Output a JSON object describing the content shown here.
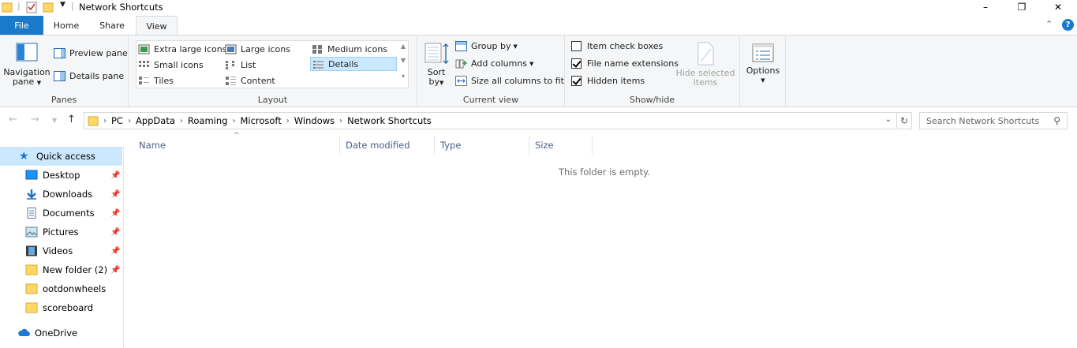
{
  "window": {
    "title": "Network Shortcuts",
    "minimize_glyph": "–",
    "restore_glyph": "❐",
    "close_glyph": "✕"
  },
  "tabs": [
    {
      "label": "File"
    },
    {
      "label": "Home"
    },
    {
      "label": "Share"
    },
    {
      "label": "View"
    }
  ],
  "ribbon": {
    "panes": {
      "navigation_pane_line1": "Navigation",
      "navigation_pane_line2": "pane",
      "preview_pane": "Preview pane",
      "details_pane": "Details pane",
      "label": "Panes"
    },
    "layout": {
      "items": [
        {
          "label": "Extra large icons"
        },
        {
          "label": "Large icons"
        },
        {
          "label": "Medium icons"
        },
        {
          "label": "Small icons"
        },
        {
          "label": "List"
        },
        {
          "label": "Details"
        },
        {
          "label": "Tiles"
        },
        {
          "label": "Content"
        }
      ],
      "selected": "Details",
      "label": "Layout"
    },
    "current_view": {
      "sort_line1": "Sort",
      "sort_line2": "by",
      "group_by": "Group by",
      "add_columns": "Add columns",
      "size_all_columns": "Size all columns to fit",
      "label": "Current view"
    },
    "show_hide": {
      "item_check_boxes": "Item check boxes",
      "file_name_extensions": "File name extensions",
      "hidden_items": "Hidden items",
      "hide_selected_line1": "Hide selected",
      "hide_selected_line2": "items",
      "label": "Show/hide",
      "item_check_boxes_checked": false,
      "file_name_extensions_checked": true,
      "hidden_items_checked": true
    },
    "options": {
      "label": "Options"
    }
  },
  "address": {
    "crumbs": [
      "PC",
      "AppData",
      "Roaming",
      "Microsoft",
      "Windows",
      "Network Shortcuts"
    ],
    "search_placeholder": "Search Network Shortcuts"
  },
  "nav_pane": {
    "items": [
      {
        "label": "Quick access",
        "icon": "star-icon"
      },
      {
        "label": "Desktop",
        "icon": "desktop-icon",
        "pinned": true
      },
      {
        "label": "Downloads",
        "icon": "download-arrow-icon",
        "pinned": true
      },
      {
        "label": "Documents",
        "icon": "document-icon",
        "pinned": true
      },
      {
        "label": "Pictures",
        "icon": "picture-icon",
        "pinned": true
      },
      {
        "label": "Videos",
        "icon": "film-icon",
        "pinned": true
      },
      {
        "label": "New folder (2)",
        "icon": "folder-icon",
        "pinned": true
      },
      {
        "label": "ootdonwheels",
        "icon": "folder-icon"
      },
      {
        "label": "scoreboard",
        "icon": "folder-icon"
      },
      {
        "label": "OneDrive",
        "icon": "cloud-icon"
      }
    ]
  },
  "columns": [
    {
      "label": "Name"
    },
    {
      "label": "Date modified"
    },
    {
      "label": "Type"
    },
    {
      "label": "Size"
    }
  ],
  "empty_message": "This folder is empty.",
  "colors": {
    "accent": "#1979ca",
    "selection": "#cce8ff",
    "folder": "#ffd866"
  }
}
